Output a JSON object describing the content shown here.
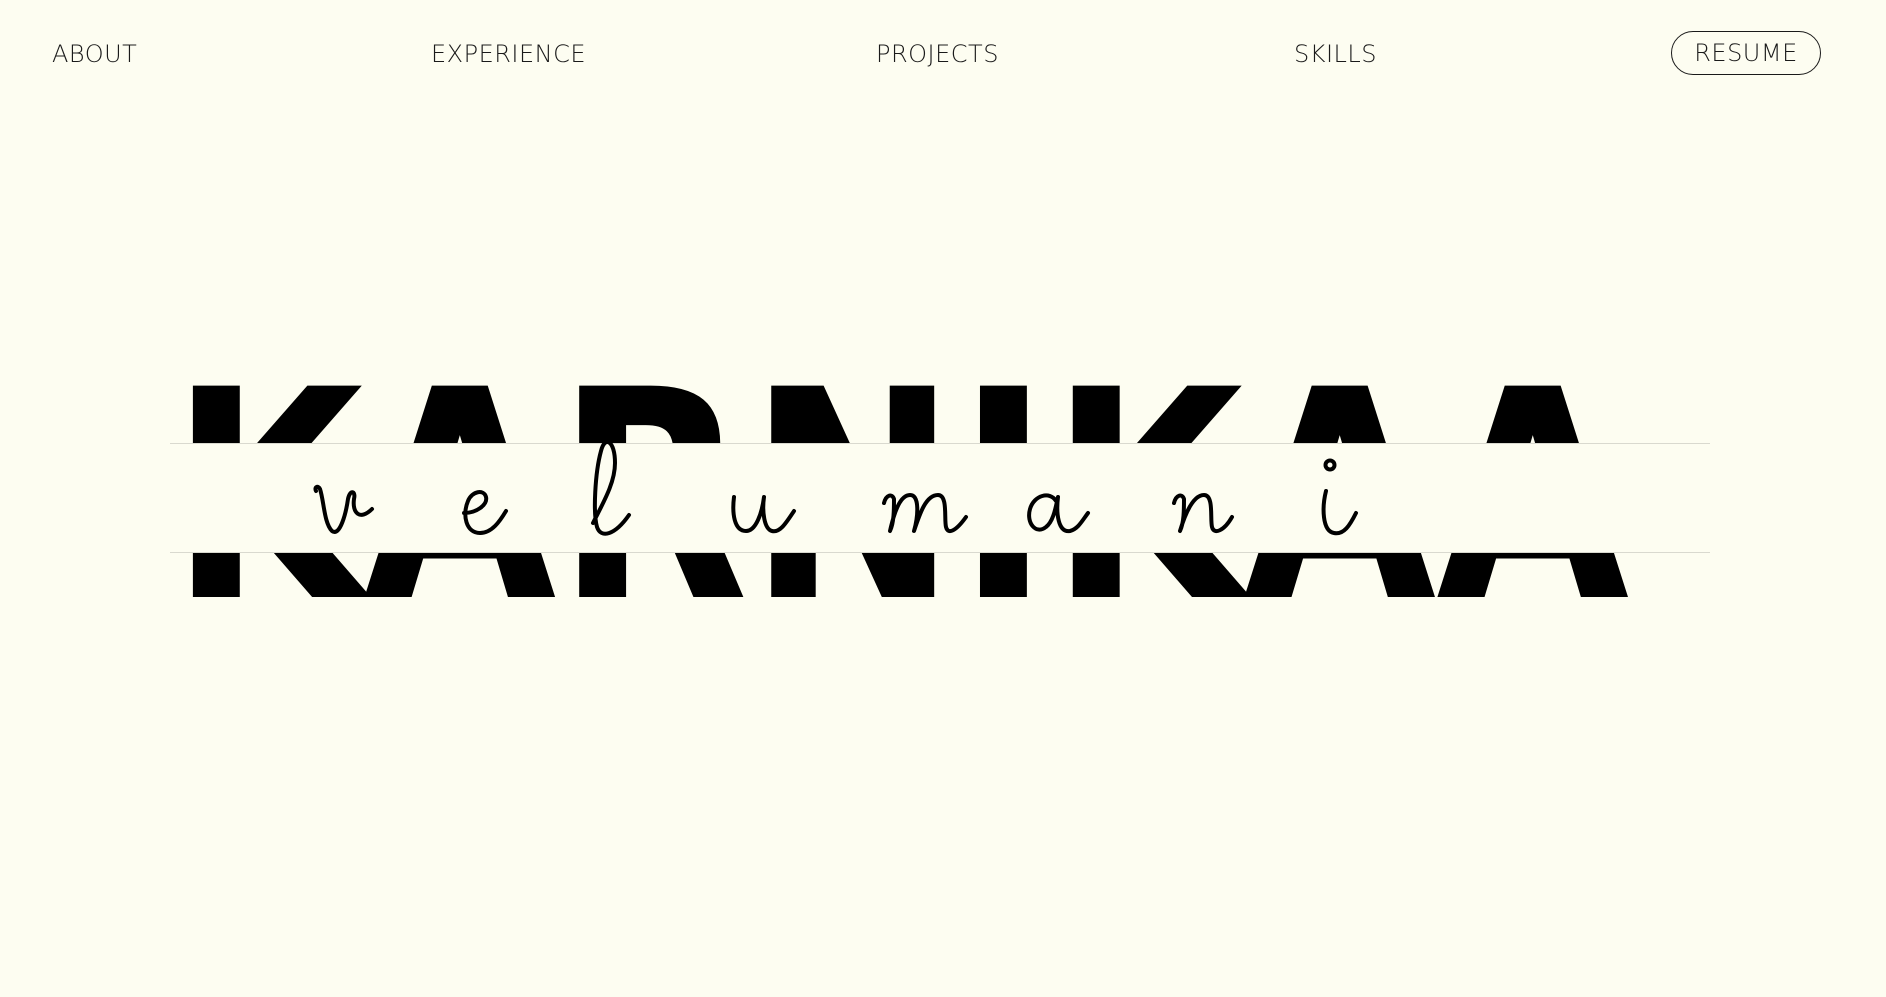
{
  "nav": {
    "about": "ABOUT",
    "experience": "EXPERIENCE",
    "projects": "PROJECTS",
    "skills": "SKILLS",
    "resume": "RESUME"
  },
  "hero": {
    "first_name": "KARNIKAA",
    "last_name": "velumani",
    "first_name_letters": [
      "K",
      "A",
      "R",
      "N",
      "I",
      "K",
      "A",
      "A"
    ],
    "last_name_letters": [
      "v",
      "e",
      "l",
      "u",
      "m",
      "a",
      "n",
      "i"
    ]
  },
  "colors": {
    "background": "#fdfdf1",
    "text": "#111111"
  }
}
